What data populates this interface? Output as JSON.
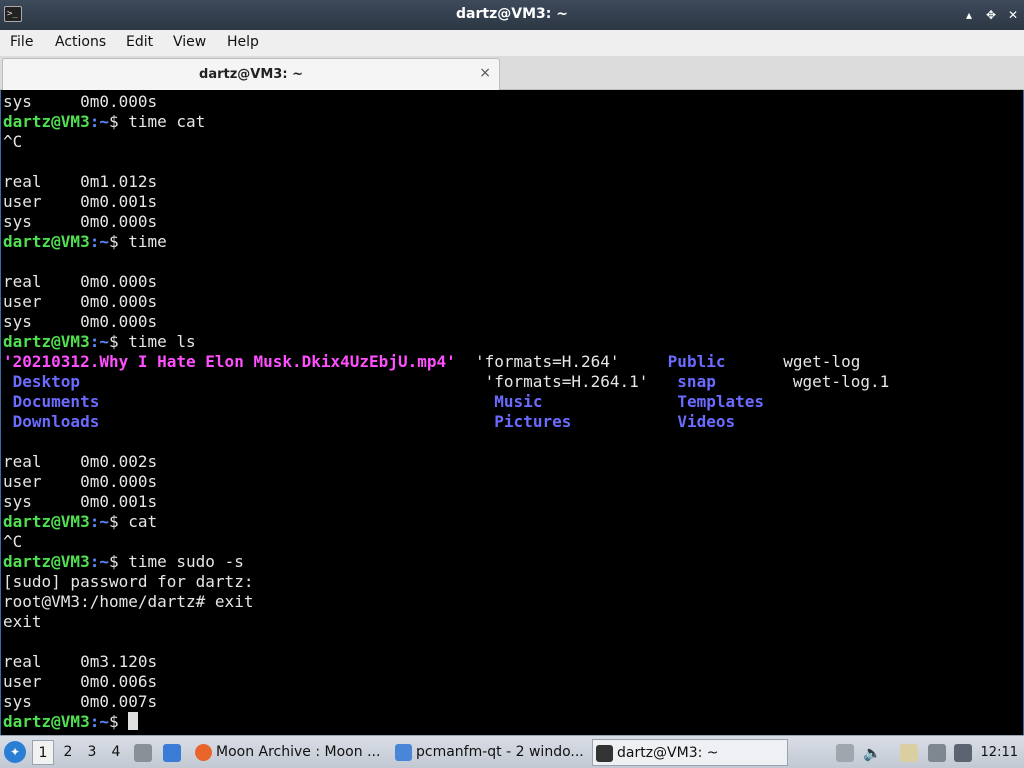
{
  "window": {
    "title": "dartz@VM3: ~",
    "app_icon_glyph": ">_",
    "controls": {
      "minimize": "▴",
      "maximize": "✥",
      "close": "✕"
    }
  },
  "menu": [
    "File",
    "Actions",
    "Edit",
    "View",
    "Help"
  ],
  "tab": {
    "label": "dartz@VM3: ~",
    "close": "×"
  },
  "terminal": {
    "prompt_user": "dartz@VM3",
    "prompt_path": ":~",
    "lines": [
      {
        "t": "sys     0m0.000s"
      },
      {
        "p": true,
        "cmd": "$ time cat"
      },
      {
        "t": "^C"
      },
      {
        "t": ""
      },
      {
        "t": "real    0m1.012s"
      },
      {
        "t": "user    0m0.001s"
      },
      {
        "t": "sys     0m0.000s"
      },
      {
        "p": true,
        "cmd": "$ time"
      },
      {
        "t": ""
      },
      {
        "t": "real    0m0.000s"
      },
      {
        "t": "user    0m0.000s"
      },
      {
        "t": "sys     0m0.000s"
      },
      {
        "p": true,
        "cmd": "$ time ls"
      },
      {
        "ls": [
          [
            "'20210312.Why I Hate Elon Musk.Dkix4UzEbjU.mp4'",
            "mp4"
          ],
          [
            "  'formats=H.264'     ",
            "plain"
          ],
          [
            "Public",
            "dir"
          ],
          [
            "      ",
            "plain"
          ],
          [
            "wget-log",
            "plain"
          ]
        ]
      },
      {
        "ls": [
          [
            " Desktop",
            "dir"
          ],
          [
            "                                          'formats=H.264.1'   ",
            "plain"
          ],
          [
            "snap",
            "dir"
          ],
          [
            "        ",
            "plain"
          ],
          [
            "wget-log.1",
            "plain"
          ]
        ]
      },
      {
        "ls": [
          [
            " Documents",
            "dir"
          ],
          [
            "                                         ",
            "plain"
          ],
          [
            "Music",
            "dir"
          ],
          [
            "              ",
            "plain"
          ],
          [
            "Templates",
            "dir"
          ]
        ]
      },
      {
        "ls": [
          [
            " Downloads",
            "dir"
          ],
          [
            "                                         ",
            "plain"
          ],
          [
            "Pictures",
            "dir"
          ],
          [
            "           ",
            "plain"
          ],
          [
            "Videos",
            "dir"
          ]
        ]
      },
      {
        "t": ""
      },
      {
        "t": "real    0m0.002s"
      },
      {
        "t": "user    0m0.000s"
      },
      {
        "t": "sys     0m0.001s"
      },
      {
        "p": true,
        "cmd": "$ cat"
      },
      {
        "t": "^C"
      },
      {
        "p": true,
        "cmd": "$ time sudo -s"
      },
      {
        "t": "[sudo] password for dartz:"
      },
      {
        "t": "root@VM3:/home/dartz# exit"
      },
      {
        "t": "exit"
      },
      {
        "t": ""
      },
      {
        "t": "real    0m3.120s"
      },
      {
        "t": "user    0m0.006s"
      },
      {
        "t": "sys     0m0.007s"
      },
      {
        "p": true,
        "cmd": "$ ",
        "cursor": true
      }
    ]
  },
  "taskbar": {
    "workspaces": [
      "1",
      "2",
      "3",
      "4"
    ],
    "active_workspace": "1",
    "tasks": [
      {
        "label": "Moon Archive : Moon ...",
        "icon": "firefox-icon",
        "color": "#e8642b"
      },
      {
        "label": "pcmanfm-qt - 2 windo...",
        "icon": "folder-icon",
        "color": "#4a86d8"
      },
      {
        "label": "dartz@VM3: ~",
        "icon": "terminal-icon",
        "color": "#333333"
      }
    ],
    "clock": "12:11"
  }
}
